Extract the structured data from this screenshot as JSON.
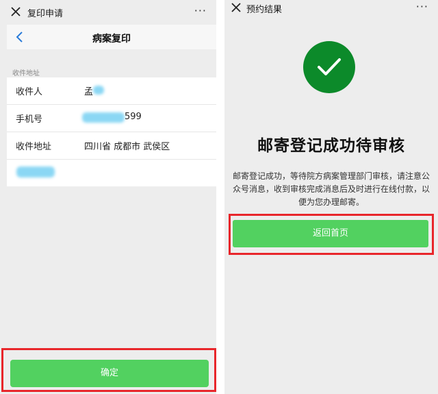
{
  "left": {
    "window_title": "复印申请",
    "more_label": "···",
    "nav_title": "病案复印",
    "section_label": "收件地址",
    "fields": [
      {
        "label": "收件人",
        "value": "孟"
      },
      {
        "label": "手机号",
        "value": "599"
      },
      {
        "label": "收件地址",
        "value": "四川省 成都市 武侯区"
      }
    ],
    "confirm_label": "确定"
  },
  "right": {
    "window_title": "预约结果",
    "more_label": "···",
    "result_title": "邮寄登记成功待审核",
    "result_message": "邮寄登记成功，等待院方病案管理部门审核，请注意公众号消息，收到审核完成消息后及时进行在线付款，以便为您办理邮寄。",
    "home_label": "返回首页"
  },
  "colors": {
    "primary_green": "#52d160",
    "success_dark_green": "#0c8a2a",
    "highlight_red": "#e8262b",
    "page_bg": "#ededed"
  },
  "icons": [
    "close-icon",
    "more-icon",
    "chevron-left-icon",
    "check-icon"
  ]
}
